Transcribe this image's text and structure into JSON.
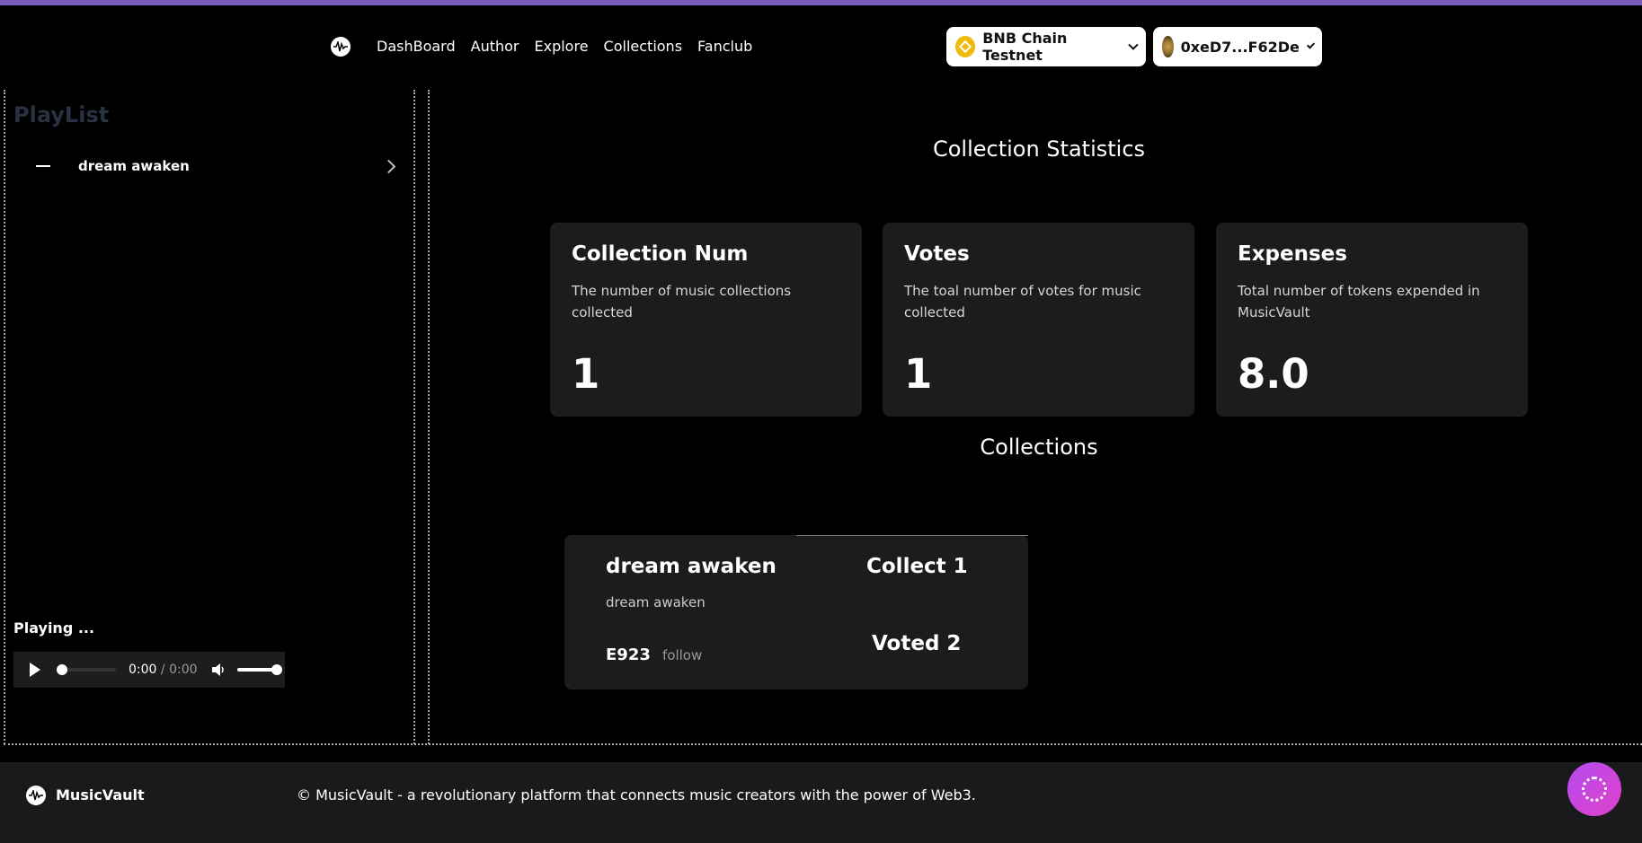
{
  "nav": {
    "items": [
      "DashBoard",
      "Author",
      "Explore",
      "Collections",
      "Fanclub"
    ]
  },
  "network": {
    "label": "BNB Chain Testnet",
    "icon": "bnb-chain-icon"
  },
  "wallet": {
    "address": "0xeD7...F62De",
    "icon": "wallet-avatar-icon"
  },
  "sidebar": {
    "title": "PlayList",
    "items": [
      {
        "label": "dream awaken"
      }
    ],
    "playing_label": "Playing ...",
    "player": {
      "current_time": "0:00",
      "separator": " / ",
      "total_time": "0:00"
    }
  },
  "stats": {
    "title": "Collection Statistics",
    "cards": [
      {
        "title": "Collection Num",
        "description": "The number of music collections collected",
        "value": "1"
      },
      {
        "title": "Votes",
        "description": "The toal number of votes for music collected",
        "value": "1"
      },
      {
        "title": "Expenses",
        "description": "Total number of tokens expended in MusicVault",
        "value": "8.0"
      }
    ]
  },
  "collections": {
    "title": "Collections",
    "items": [
      {
        "name": "dream awaken",
        "subtitle": "dream awaken",
        "author": "E923",
        "follow_label": "follow",
        "collect_label": "Collect 1",
        "voted_label": "Voted 2"
      }
    ]
  },
  "footer": {
    "brand": "MusicVault",
    "text": "© MusicVault - a revolutionary platform that connects music creators with the power of Web3."
  },
  "colors": {
    "accent": "#7b5cb8",
    "card_bg": "#1c1c1e",
    "bnb": "#f0b90b"
  }
}
